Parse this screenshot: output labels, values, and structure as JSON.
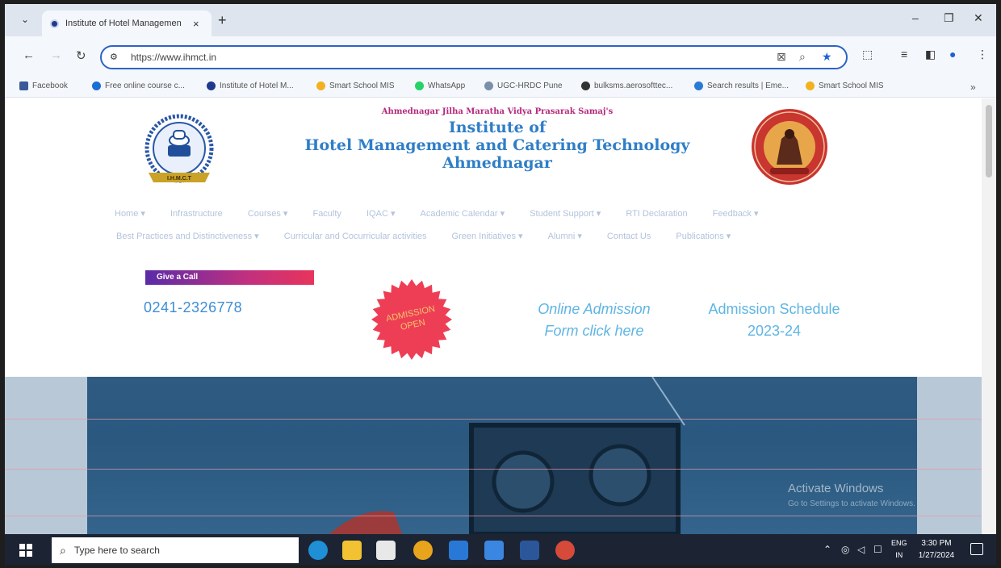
{
  "browser": {
    "tab_title": "Institute of Hotel Managemen",
    "tab_close": "×",
    "new_tab": "+",
    "url": "https://www.ihmct.in",
    "window": {
      "minimize": "–",
      "restore": "❐",
      "close": "✕"
    }
  },
  "bookmarks": [
    {
      "label": "Facebook",
      "color": "#3b5998"
    },
    {
      "label": "Free online course c...",
      "color": "#1a6fd6"
    },
    {
      "label": "Institute of Hotel M...",
      "color": "#1f3a8a"
    },
    {
      "label": "Smart School MIS",
      "color": "#f2b21f"
    },
    {
      "label": "WhatsApp",
      "color": "#25d366"
    },
    {
      "label": "UGC-HRDC Pune",
      "color": "#7b8fa8"
    },
    {
      "label": "bulksms.aerosofttec...",
      "color": "#333333"
    },
    {
      "label": "Search results | Eme...",
      "color": "#2a7bd6"
    },
    {
      "label": "Smart School MIS",
      "color": "#f2b21f"
    }
  ],
  "bookmarks_overflow": "»",
  "site": {
    "society": "Ahmednagar Jilha Maratha Vidya Prasarak Samaj's",
    "title_line1": "Institute of",
    "title_line2": "Hotel Management and Catering Technology",
    "title_line3": "Ahmednagar",
    "logo_text": "I.H.M.C.T",
    "nav_row1": [
      "Home ▾",
      "Infrastructure",
      "Courses ▾",
      "Faculty",
      "IQAC ▾",
      "Academic Calendar ▾",
      "Student Support ▾",
      "RTI Declaration",
      "Feedback ▾"
    ],
    "nav_row2": [
      "Best Practices and Distinctiveness ▾",
      "Curricular and Cocurricular activities",
      "Green Initiatives ▾",
      "Alumni ▾",
      "Contact Us",
      "Publications ▾"
    ],
    "give_call": "Give a Call",
    "phone": "0241-2326778",
    "badge_line1": "ADMISSION",
    "badge_line2": "OPEN",
    "online_line1": "Online Admission",
    "online_line2": "Form click here",
    "schedule_line1": "Admission Schedule",
    "schedule_line2": "2023-24"
  },
  "watermark": {
    "title": "Activate Windows",
    "subtitle": "Go to Settings to activate Windows."
  },
  "taskbar": {
    "search_placeholder": "Type here to search",
    "lang_line1": "ENG",
    "lang_line2": "IN",
    "time": "3:30 PM",
    "date": "1/27/2024",
    "apps": [
      {
        "name": "edge",
        "color": "#1f8fd6"
      },
      {
        "name": "file-explorer",
        "color": "#f2c233"
      },
      {
        "name": "store",
        "color": "#e8e8e8"
      },
      {
        "name": "chrome",
        "color": "#e8a41c"
      },
      {
        "name": "mail",
        "color": "#2a78d6"
      },
      {
        "name": "photos",
        "color": "#3a86e0"
      },
      {
        "name": "word",
        "color": "#2b579a"
      },
      {
        "name": "chrome-profile",
        "color": "#d64a3a"
      }
    ]
  }
}
